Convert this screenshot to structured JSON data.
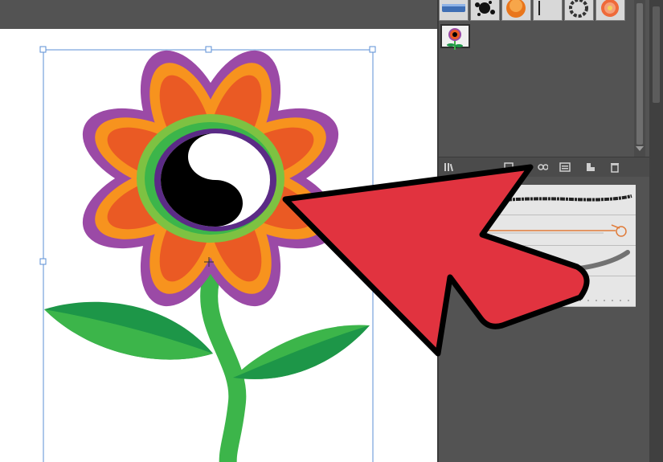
{
  "app": {
    "panels": {
      "symbols": {
        "items": [
          {
            "icon": "blue-banner-symbol-icon"
          },
          {
            "icon": "ink-splatter-symbol-icon"
          },
          {
            "icon": "orange-button-symbol-icon"
          },
          {
            "icon": "divider-symbol-icon"
          },
          {
            "icon": "frame-symbol-icon"
          },
          {
            "icon": "flower-symbol-icon"
          },
          {
            "icon": "yin-yang-flower-symbol-icon",
            "selected": true
          }
        ],
        "toolbar_icons": [
          "symbol-library-icon",
          "place-symbol-icon",
          "break-link-icon",
          "symbol-options-icon",
          "new-symbol-icon",
          "delete-symbol-icon"
        ]
      },
      "brushes": {
        "rows": [
          {
            "icon": "charcoal-brush-icon"
          },
          {
            "icon": "arrow-art-brush-icon"
          },
          {
            "icon": "dry-brush-icon"
          },
          {
            "icon": "pattern-brush-icon"
          }
        ]
      }
    },
    "artwork": {
      "icon": "yin-yang-flower-artwork",
      "colors": {
        "outer_petal": "#9b4aa6",
        "mid_petal": "#f7931e",
        "inner_petal": "#ea5a24",
        "green_ring": "#7dc242",
        "purple_ring": "#5b2b86",
        "leaf_dark": "#1d9648",
        "leaf_light": "#3cb54a",
        "stem": "#3cb54a"
      }
    },
    "annotation": {
      "icon": "red-arrow-icon",
      "color": "#e1333f"
    },
    "selection": {
      "color": "#5b8fd6"
    }
  }
}
